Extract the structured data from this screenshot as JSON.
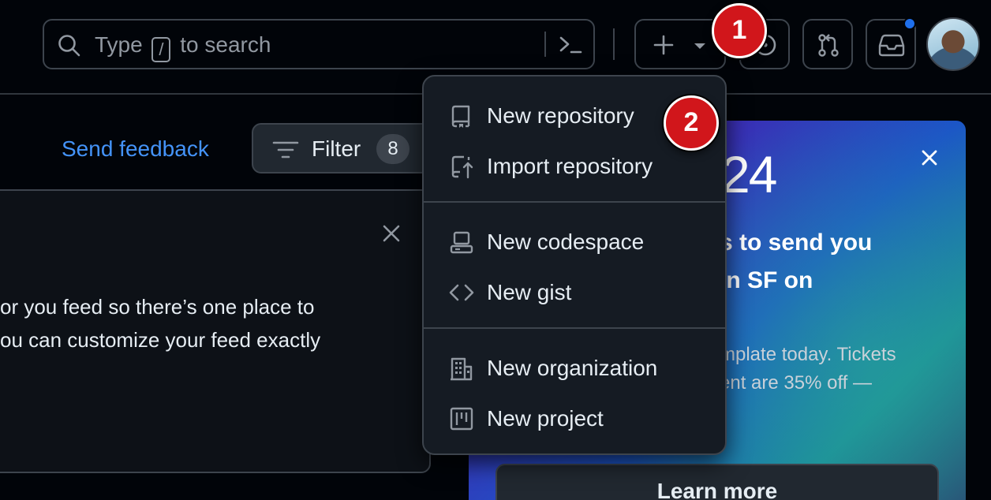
{
  "search": {
    "text_before": "Type",
    "key": "/",
    "text_after": "to search"
  },
  "header": {
    "create_icon": "plus-icon",
    "create_caret_icon": "triangle-down-icon",
    "issues_icon": "issue-opened-icon",
    "pull_requests_icon": "git-pull-request-icon",
    "inbox_icon": "inbox-icon",
    "notification_indicator_color": "#1f6feb"
  },
  "steps": [
    "1",
    "2"
  ],
  "main": {
    "send_feedback": "Send feedback",
    "filter_label": "Filter",
    "filter_count": "8",
    "card_text_lines": [
      "or you feed so there’s one place to",
      "ou can customize your feed exactly"
    ]
  },
  "promo": {
    "big_text": "24",
    "heading_lines": [
      "s to send you",
      "in SF on"
    ],
    "body_lines": [
      "mplate today. Tickets",
      "ent are 35% off —"
    ],
    "learn_more": "Learn more"
  },
  "create_menu": {
    "items": [
      {
        "label": "New repository",
        "icon": "repo-icon"
      },
      {
        "label": "Import repository",
        "icon": "repo-push-icon"
      },
      {
        "label": "New codespace",
        "icon": "codespaces-icon"
      },
      {
        "label": "New gist",
        "icon": "code-icon"
      },
      {
        "label": "New organization",
        "icon": "organization-icon"
      },
      {
        "label": "New project",
        "icon": "project-icon"
      }
    ]
  },
  "colors": {
    "background": "#010409",
    "link": "#4493f8",
    "step_badge": "#d1161b",
    "menu_bg": "#151b23",
    "border": "#3d444d"
  }
}
